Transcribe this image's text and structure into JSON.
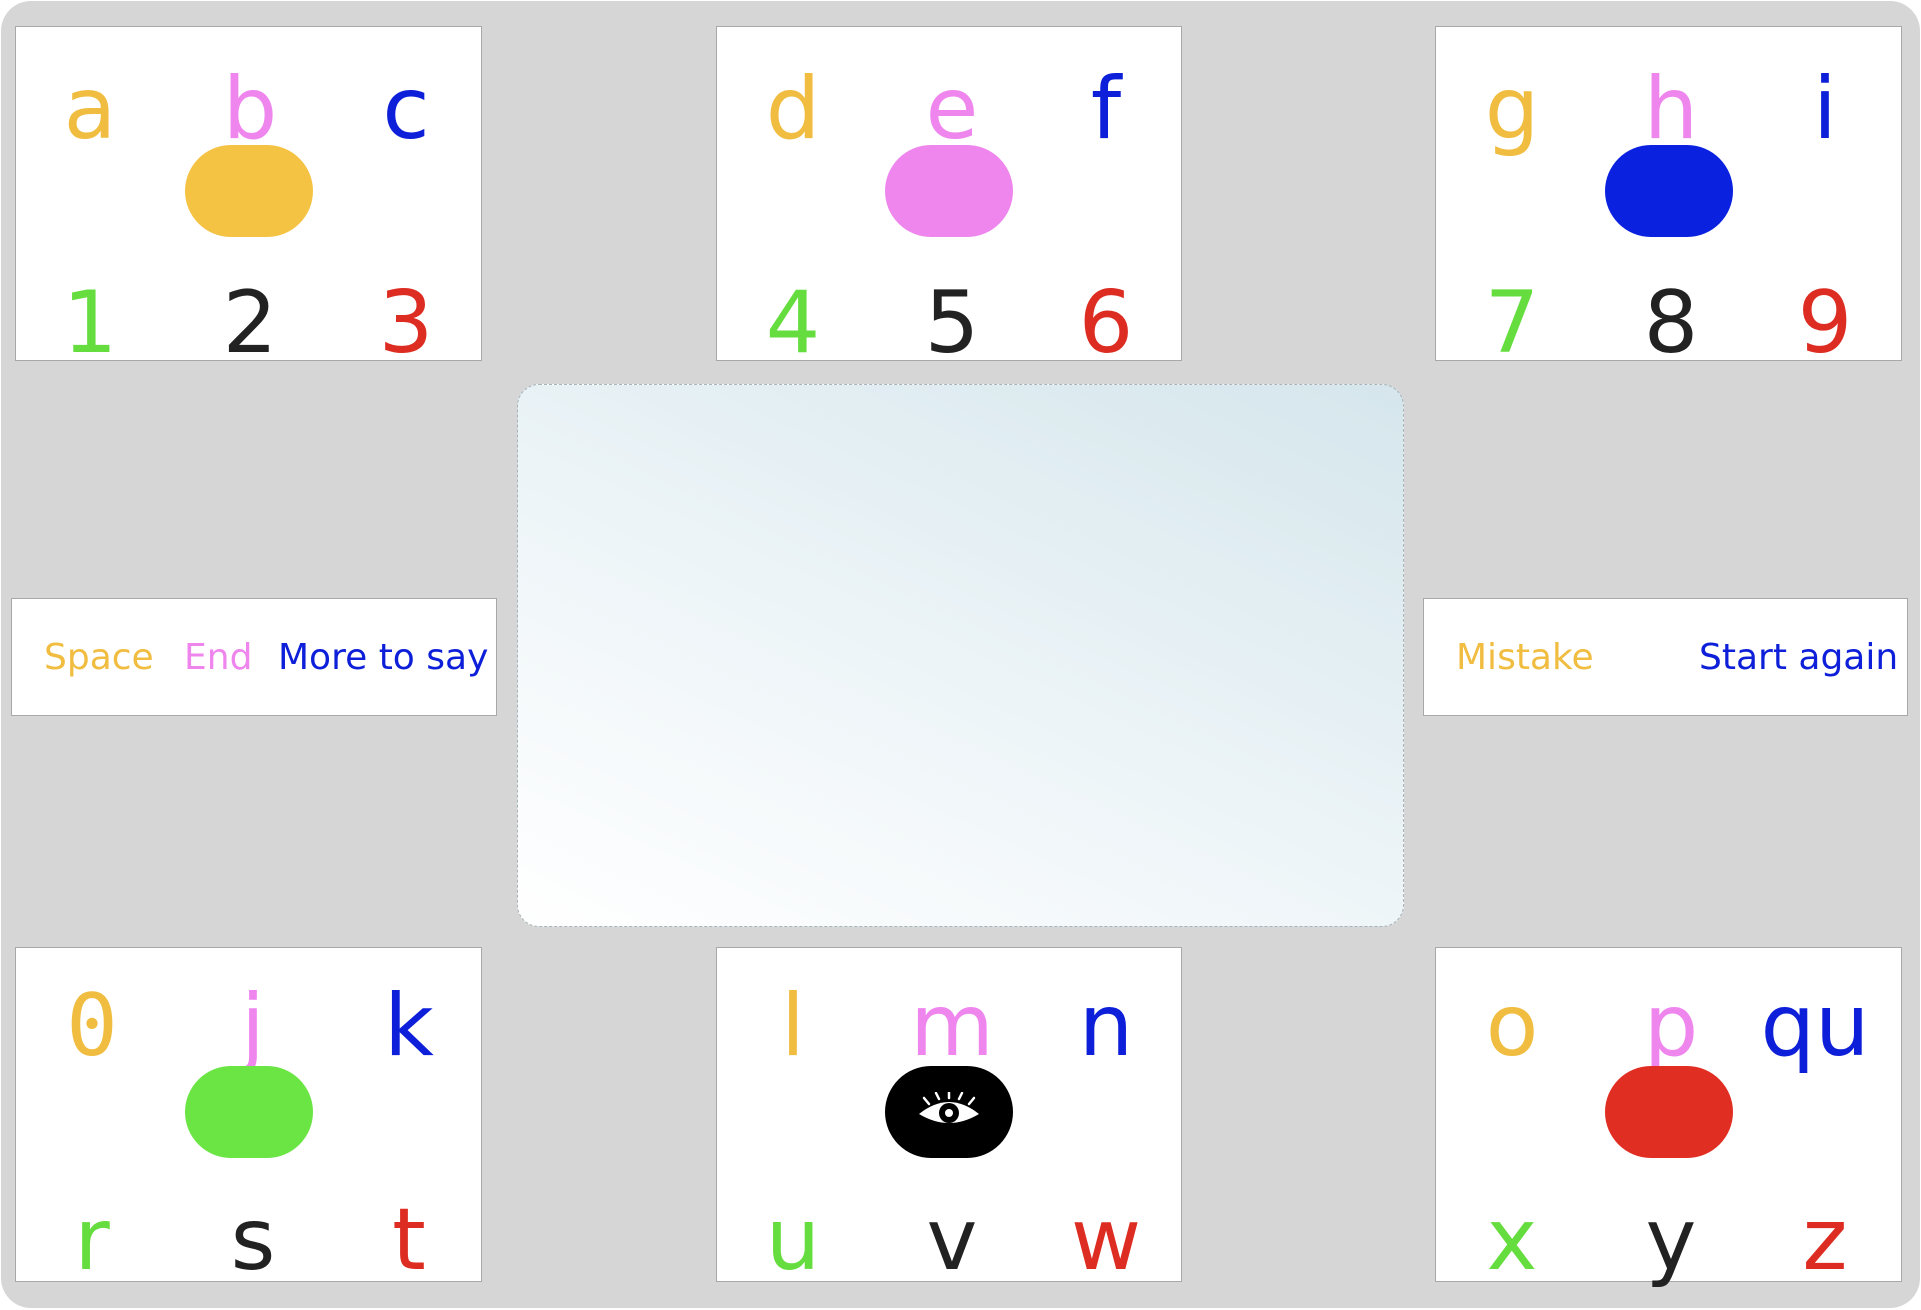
{
  "colors": {
    "orange": "#f0bd40",
    "pink": "#ef86ee",
    "blue": "#0d1fd8",
    "green": "#66dd3f",
    "black": "#222222",
    "red": "#dd2d22"
  },
  "keys": [
    {
      "letters": [
        "a",
        "b",
        "c"
      ],
      "digits": [
        "1",
        "2",
        "3"
      ],
      "pill": "orange"
    },
    {
      "letters": [
        "d",
        "e",
        "f"
      ],
      "digits": [
        "4",
        "5",
        "6"
      ],
      "pill": "pink"
    },
    {
      "letters": [
        "g",
        "h",
        "i"
      ],
      "digits": [
        "7",
        "8",
        "9"
      ],
      "pill": "blue"
    },
    {
      "letters": [
        "0",
        "j",
        "k"
      ],
      "digits": [
        "r",
        "s",
        "t"
      ],
      "pill": "green"
    },
    {
      "letters": [
        "l",
        "m",
        "n"
      ],
      "digits": [
        "u",
        "v",
        "w"
      ],
      "pill": "black",
      "pill_icon": "eye-icon"
    },
    {
      "letters": [
        "o",
        "p",
        "qu"
      ],
      "digits": [
        "x",
        "y",
        "z"
      ],
      "pill": "red"
    }
  ],
  "controls_left": {
    "space": "Space",
    "end": "End",
    "more": "More to say"
  },
  "controls_right": {
    "mistake": "Mistake",
    "start_again": "Start again"
  },
  "display": {
    "text": ""
  }
}
